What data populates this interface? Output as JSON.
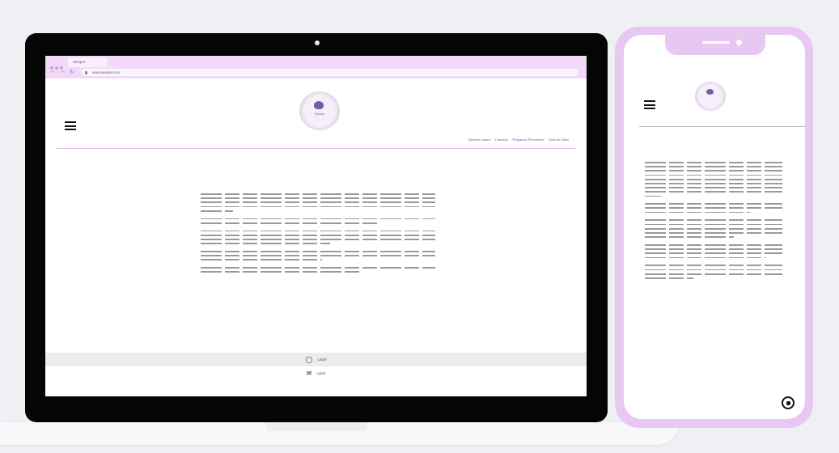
{
  "browser": {
    "tab_title": "Wespai",
    "url": "www.wespai.com"
  },
  "site": {
    "logo_text": "Sinsara",
    "menu": [
      "Quienes somos",
      "Contacto",
      "Preguntas Frecuentes",
      "Guía de tallas"
    ],
    "footer": {
      "whatsapp_label": "Label",
      "email_label": "Label"
    }
  },
  "icons": {
    "menu": "hamburger-icon",
    "whatsapp": "whatsapp-icon",
    "email": "mail-icon"
  },
  "colors": {
    "accent": "#f2d9f7",
    "menu_text": "#7b4a9c",
    "phone_frame": "#e8c7f2"
  }
}
